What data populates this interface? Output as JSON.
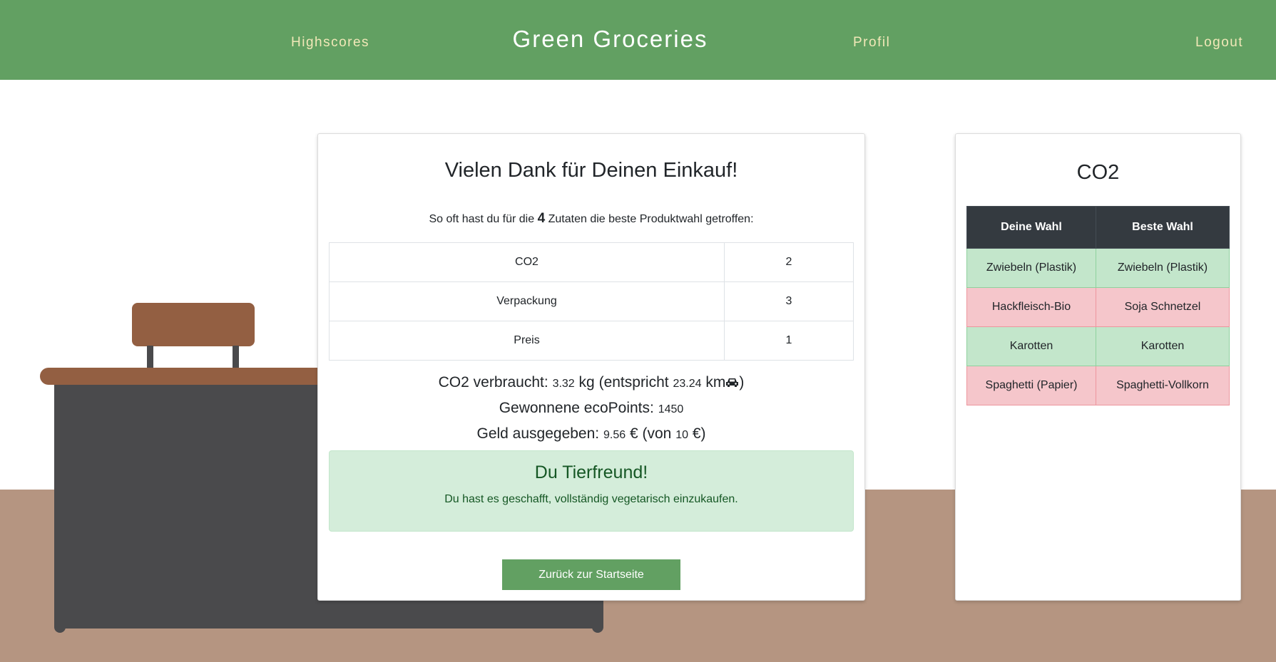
{
  "header": {
    "brand": "Green Groceries",
    "nav": {
      "highscores": "Highscores",
      "profile": "Profil",
      "logout": "Logout"
    }
  },
  "result": {
    "title": "Vielen Dank für Deinen Einkauf!",
    "intro_before": "So oft hast du für die",
    "ingredient_count": "4",
    "intro_after": "Zutaten die beste Produktwahl getroffen:",
    "scores": [
      {
        "label": "CO2",
        "value": "2"
      },
      {
        "label": "Verpackung",
        "value": "3"
      },
      {
        "label": "Preis",
        "value": "1"
      }
    ],
    "co2": {
      "label": "CO2 verbraucht:",
      "value": "3.32",
      "unit": "kg",
      "equiv_label": "(entspricht",
      "km_value": "23.24",
      "km_unit": "km",
      "close": ")"
    },
    "eco": {
      "label": "Gewonnene ecoPoints:",
      "value": "1450"
    },
    "money": {
      "label": "Geld ausgegeben:",
      "value": "9.56",
      "unit": "€",
      "budget_label": "(von",
      "budget_value": "10",
      "budget_unit": "€)"
    },
    "achievement": {
      "title": "Du Tierfreund!",
      "text": "Du hast es geschafft, vollständig vegetarisch einzukaufen."
    },
    "back_button": "Zurück zur Startseite"
  },
  "co2_panel": {
    "title": "CO2",
    "headers": [
      "Deine Wahl",
      "Beste Wahl"
    ],
    "rows": [
      {
        "yours": "Zwiebeln (Plastik)",
        "best": "Zwiebeln (Plastik)",
        "status": "match"
      },
      {
        "yours": "Hackfleisch-Bio",
        "best": "Soja Schnetzel",
        "status": "mismatch"
      },
      {
        "yours": "Karotten",
        "best": "Karotten",
        "status": "match"
      },
      {
        "yours": "Spaghetti (Papier)",
        "best": "Spaghetti-Vollkorn",
        "status": "mismatch"
      }
    ]
  },
  "colors": {
    "header_bg": "#62a062",
    "nav_text": "#f2e8b8",
    "match_row": "#c3e6cb",
    "mismatch_row": "#f5c6cb",
    "table_head": "#343a40",
    "floor": "#b59581",
    "counter": "#4a4a4c",
    "wood": "#935f42"
  },
  "icons": {
    "car": "car-icon"
  }
}
